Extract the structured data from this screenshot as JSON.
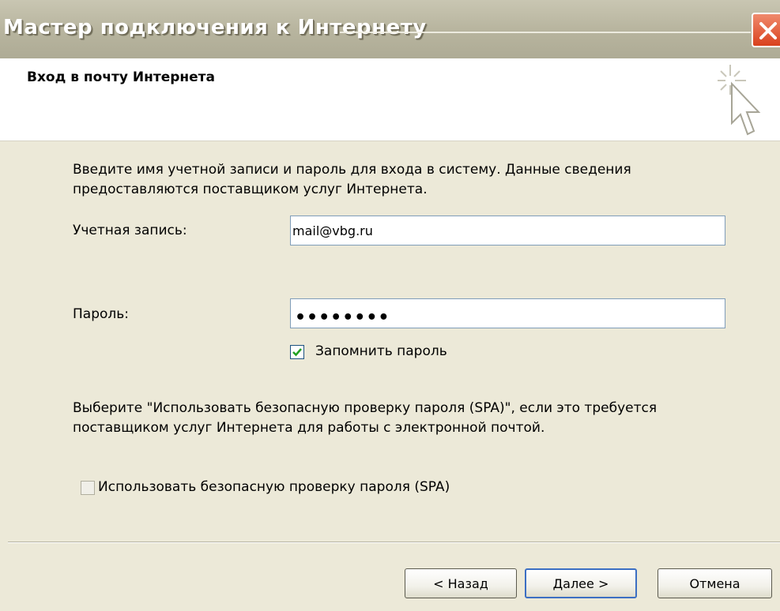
{
  "window": {
    "title": "Мастер подключения к Интернету",
    "close_glyph": "✕"
  },
  "header": {
    "title": "Вход в почту Интернета",
    "icon": "wizard-cursor-icon"
  },
  "form": {
    "intro": "Введите имя учетной записи и пароль для входа в систему. Данные сведения предоставляются поставщиком услуг Интернета.",
    "account_label": "Учетная запись:",
    "account_value": "mail@vbg.ru",
    "password_label": "Пароль:",
    "password_mask": "••••••••",
    "remember_label": "Запомнить пароль",
    "remember_checked": true,
    "spa_info": "Выберите \"Использовать безопасную проверку пароля (SPA)\", если это требуется поставщиком услуг Интернета для работы с электронной почтой.",
    "spa_label": "Использовать безопасную проверку пароля (SPA)",
    "spa_checked": false
  },
  "buttons": {
    "back": "< Назад",
    "next": "Далее >",
    "cancel": "Отмена"
  },
  "colors": {
    "dialog_bg": "#ECE9D8",
    "title_text": "#FFFFFF",
    "close_red": "#D9411E",
    "check_green": "#21A121",
    "default_button_border": "#3C6FC3"
  }
}
